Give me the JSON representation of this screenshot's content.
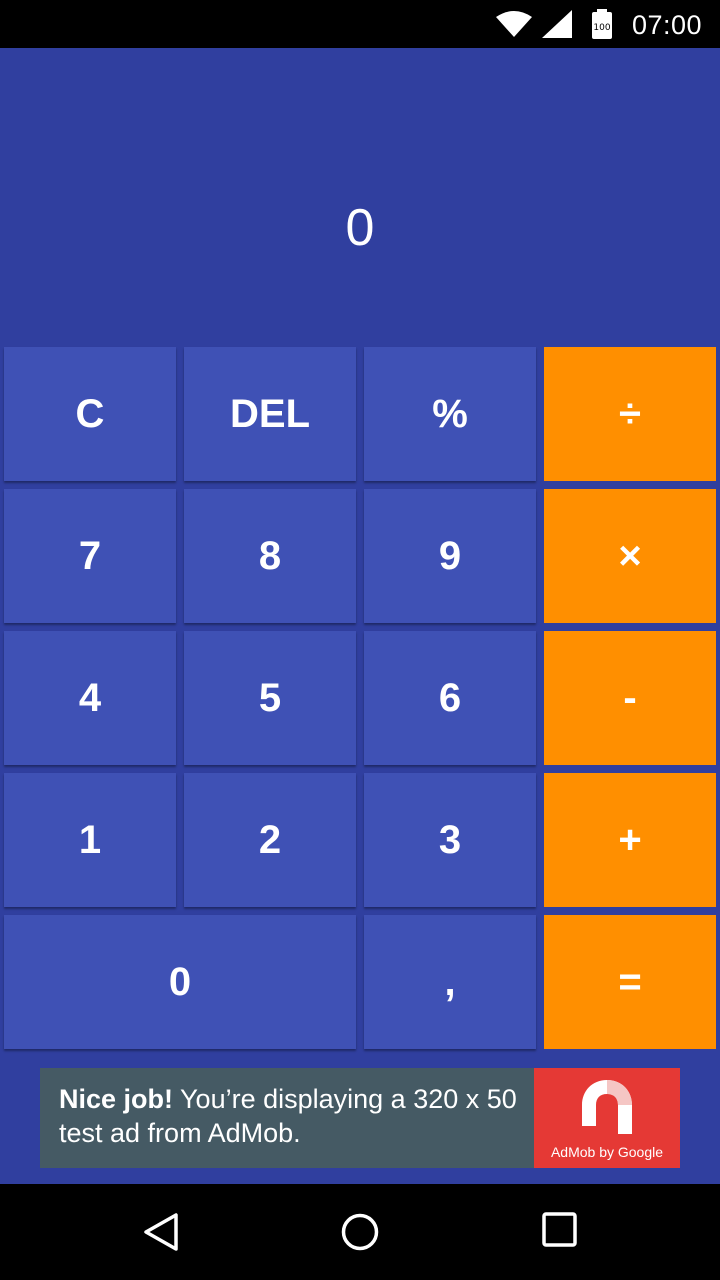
{
  "status_bar": {
    "time": "07:00",
    "battery_level": "100",
    "icons": [
      "wifi-icon",
      "cell-signal-icon",
      "battery-icon"
    ]
  },
  "display": {
    "value": "0"
  },
  "keypad": {
    "rows": [
      [
        "C",
        "DEL",
        "%",
        "÷"
      ],
      [
        "7",
        "8",
        "9",
        "×"
      ],
      [
        "4",
        "5",
        "6",
        "-"
      ],
      [
        "1",
        "2",
        "3",
        "+"
      ],
      [
        "0",
        ",",
        "="
      ]
    ]
  },
  "ad": {
    "bold_text": "Nice job!",
    "text": " You’re displaying a 320 x 50 test ad from AdMob.",
    "logo_caption": "AdMob by Google"
  },
  "nav_bar": {
    "icons": [
      "back-icon",
      "home-icon",
      "recent-apps-icon"
    ]
  },
  "colors": {
    "background": "#303F9F",
    "key": "#3F51B5",
    "operator_key": "#FF8F00",
    "ad_background": "#455A64",
    "ad_logo": "#E53935"
  }
}
